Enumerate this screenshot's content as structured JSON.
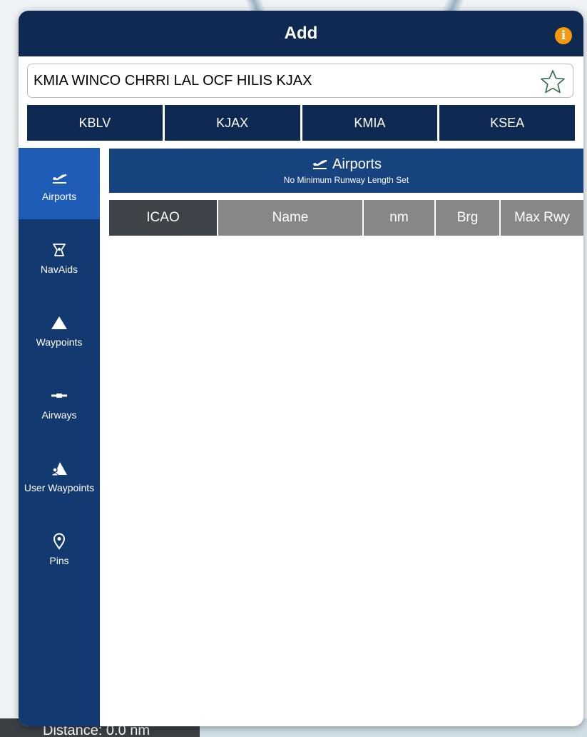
{
  "header": {
    "title": "Add",
    "info_icon": "info-icon"
  },
  "route": {
    "value": "KMIA WINCO CHRRI LAL OCF HILIS KJAX",
    "favorite_icon": "star-outline-icon"
  },
  "quick_airports": [
    "KBLV",
    "KJAX",
    "KMIA",
    "KSEA"
  ],
  "sidebar": {
    "active_index": 0,
    "items": [
      {
        "label": "Airports",
        "icon": "airplane-takeoff-icon"
      },
      {
        "label": "NavAids",
        "icon": "navaid-icon"
      },
      {
        "label": "Waypoints",
        "icon": "triangle-icon"
      },
      {
        "label": "Airways",
        "icon": "airway-icon"
      },
      {
        "label": "User Waypoints",
        "icon": "user-waypoint-icon"
      },
      {
        "label": "Pins",
        "icon": "pin-icon"
      }
    ]
  },
  "results": {
    "title": "Airports",
    "subtitle": "No Minimum Runway Length Set",
    "columns": [
      "ICAO",
      "Name",
      "nm",
      "Brg",
      "Max Rwy"
    ],
    "sorted_column": "ICAO"
  },
  "map": {
    "distance_text": "Distance: 0.0 nm"
  },
  "colors": {
    "header": "#0f2a52",
    "sidebar": "#133a70",
    "sidebar_active": "#1e5cb8",
    "info": "#f39a12"
  }
}
